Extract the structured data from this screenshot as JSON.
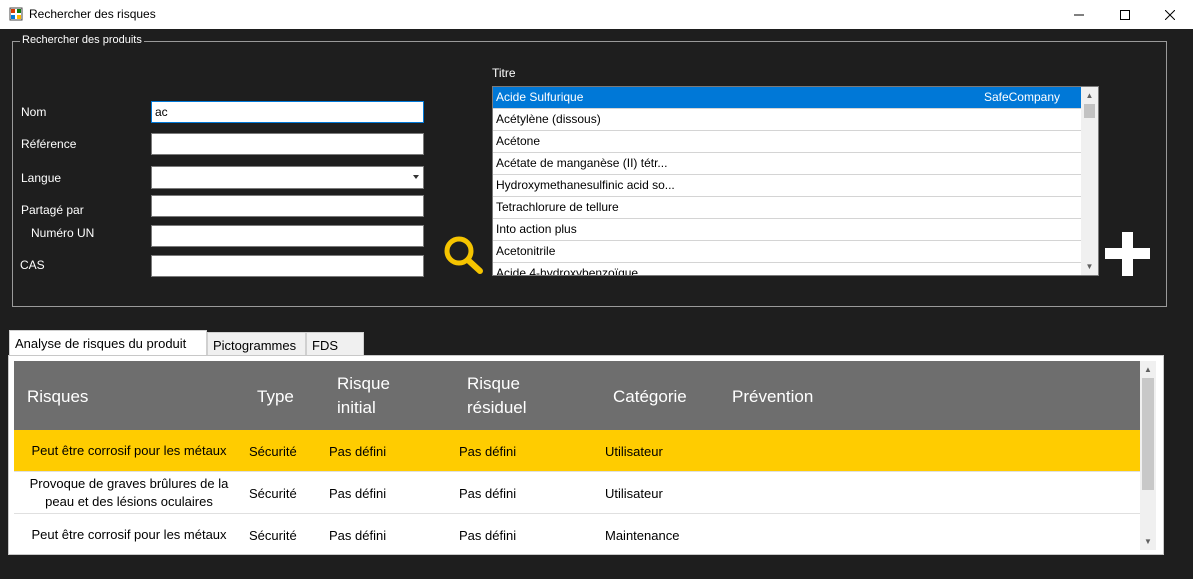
{
  "window": {
    "title": "Rechercher des risques",
    "minimize_glyph": "—",
    "maximize_glyph": "☐",
    "close_glyph": "✕"
  },
  "search_group": {
    "legend": "Rechercher des produits",
    "fields": {
      "nom": {
        "label": "Nom",
        "value": "ac"
      },
      "reference": {
        "label": "Référence",
        "value": ""
      },
      "langue": {
        "label": "Langue",
        "value": ""
      },
      "partage_par": {
        "label": "Partagé par",
        "value": ""
      },
      "numero_un": {
        "label": "Numéro UN",
        "value": ""
      },
      "cas": {
        "label": "CAS",
        "value": ""
      }
    }
  },
  "results": {
    "label": "Titre",
    "items": [
      {
        "title": "Acide Sulfurique",
        "company": "SafeCompany",
        "selected": true
      },
      {
        "title": "Acétylène (dissous)",
        "company": ""
      },
      {
        "title": "Acétone",
        "company": ""
      },
      {
        "title": "Acétate de manganèse (II) tétr...",
        "company": ""
      },
      {
        "title": "Hydroxymethanesulfinic acid so...",
        "company": ""
      },
      {
        "title": "Tetrachlorure de tellure",
        "company": ""
      },
      {
        "title": "Into action plus",
        "company": ""
      },
      {
        "title": "Acetonitrile",
        "company": ""
      },
      {
        "title": "Acide 4-hydroxybenzoïque",
        "company": ""
      }
    ]
  },
  "tabs": [
    {
      "label": "Analyse de risques du produit",
      "active": true
    },
    {
      "label": "Pictogrammes",
      "active": false
    },
    {
      "label": "FDS",
      "active": false
    }
  ],
  "grid": {
    "headers": {
      "risques": "Risques",
      "type": "Type",
      "risque_initial_1": "Risque",
      "risque_initial_2": "initial",
      "risque_residuel_1": "Risque",
      "risque_residuel_2": "résiduel",
      "categorie": "Catégorie",
      "prevention": "Prévention"
    },
    "rows": [
      {
        "risque": "Peut être corrosif pour les métaux",
        "type": "Sécurité",
        "initial": "Pas défini",
        "residuel": "Pas défini",
        "categorie": "Utilisateur",
        "prevention": "",
        "highlighted": true
      },
      {
        "risque": "Provoque de graves brûlures de la peau et des lésions oculaires",
        "type": "Sécurité",
        "initial": "Pas défini",
        "residuel": "Pas défini",
        "categorie": "Utilisateur",
        "prevention": ""
      },
      {
        "risque": "Peut être corrosif pour les métaux",
        "type": "Sécurité",
        "initial": "Pas défini",
        "residuel": "Pas défini",
        "categorie": "Maintenance",
        "prevention": ""
      }
    ]
  },
  "colors": {
    "background": "#1e1e1e",
    "selection": "#0078d7",
    "highlight_row": "#ffcc00",
    "search_icon": "#f5c400",
    "grid_header": "#6e6e6e"
  },
  "icons": {
    "search": "search-icon",
    "add": "plus-icon"
  }
}
